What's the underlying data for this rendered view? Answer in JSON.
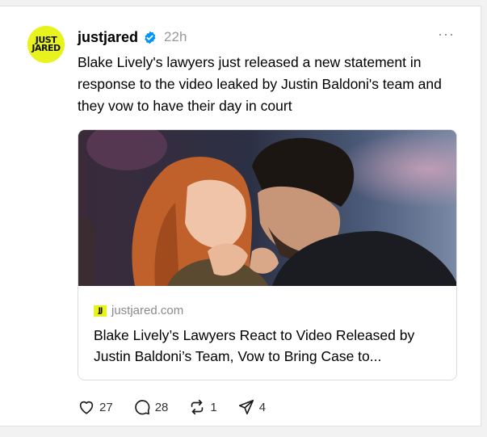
{
  "post": {
    "avatar_line1": "JUST",
    "avatar_line2": "JARED",
    "username": "justjared",
    "verified_icon": "verified-badge-icon",
    "time_ago": "22h",
    "more_label": "···",
    "text": "Blake Lively's lawyers just released a new statement in response to the video leaked by Justin Baldoni's team and they vow to have their day in court",
    "link": {
      "favicon_text": "JJ",
      "domain": "justjared.com",
      "title": "Blake Lively’s Lawyers React to Video Released by Justin Baldoni’s Team, Vow to Bring Case to..."
    },
    "actions": {
      "likes": "27",
      "comments": "28",
      "reposts": "1",
      "shares": "4"
    }
  },
  "colors": {
    "brand_yellow": "#e8f21c",
    "verified_blue": "#0095f6",
    "muted_text": "#999999"
  }
}
